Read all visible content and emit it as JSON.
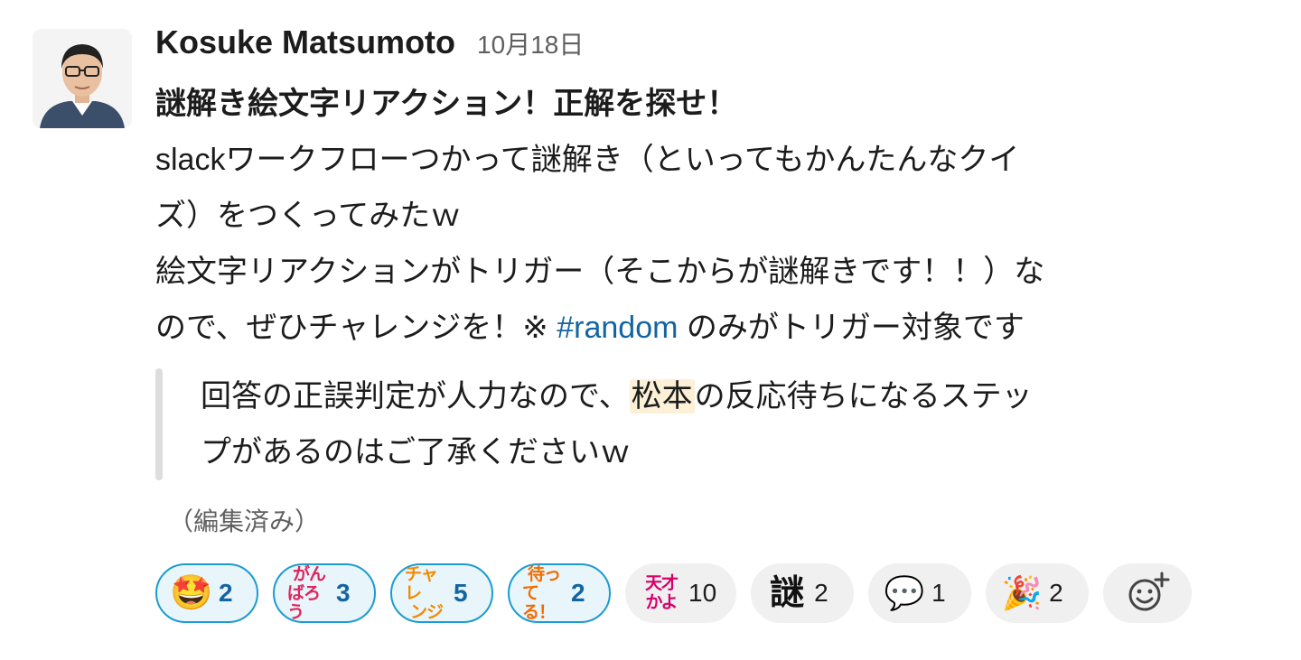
{
  "message": {
    "author": "Kosuke Matsumoto",
    "timestamp": "10月18日",
    "title": "謎解き絵文字リアクション！正解を探せ！",
    "lines": [
      "slackワークフローつかって謎解き（といってもかんたんなクイ",
      "ズ）をつくってみたｗ",
      "絵文字リアクションがトリガー（そこからが謎解きです！！）な"
    ],
    "line4_before": "ので、ぜひチャレンジを！※ ",
    "channel": "#random",
    "line4_after": " のみがトリガー対象です",
    "quote": {
      "line1_before": "回答の正誤判定が人力なので、",
      "mention": "松本",
      "line1_after": "の反応待ちになるステッ",
      "line2": "プがあるのはご了承くださいｗ"
    },
    "edited": "（編集済み）"
  },
  "reactions": [
    {
      "emoji": "star-struck",
      "glyph": "🤩",
      "count": "2",
      "active": true
    },
    {
      "emoji": "ganbarou",
      "glyph_top": "がん",
      "glyph_bottom": "ばろう",
      "color": "#e0245e",
      "count": "3",
      "active": true
    },
    {
      "emoji": "challenge",
      "glyph_top": "チャレ",
      "glyph_bottom": "ンジ",
      "color": "#f28b00",
      "count": "5",
      "active": true
    },
    {
      "emoji": "matteru",
      "glyph_top": "待っ",
      "glyph_bottom": "てる！",
      "color": "#f26b00",
      "count": "2",
      "active": true
    },
    {
      "emoji": "tensai-kayo",
      "glyph_top": "天才",
      "glyph_bottom": "かよ",
      "color": "#d6006b",
      "count": "10",
      "active": false
    },
    {
      "emoji": "nazo",
      "glyph": "謎",
      "count": "2",
      "active": false
    },
    {
      "emoji": "speech-balloon",
      "glyph": "💬",
      "count": "1",
      "active": false
    },
    {
      "emoji": "tada",
      "glyph": "🎉",
      "count": "2",
      "active": false
    }
  ]
}
